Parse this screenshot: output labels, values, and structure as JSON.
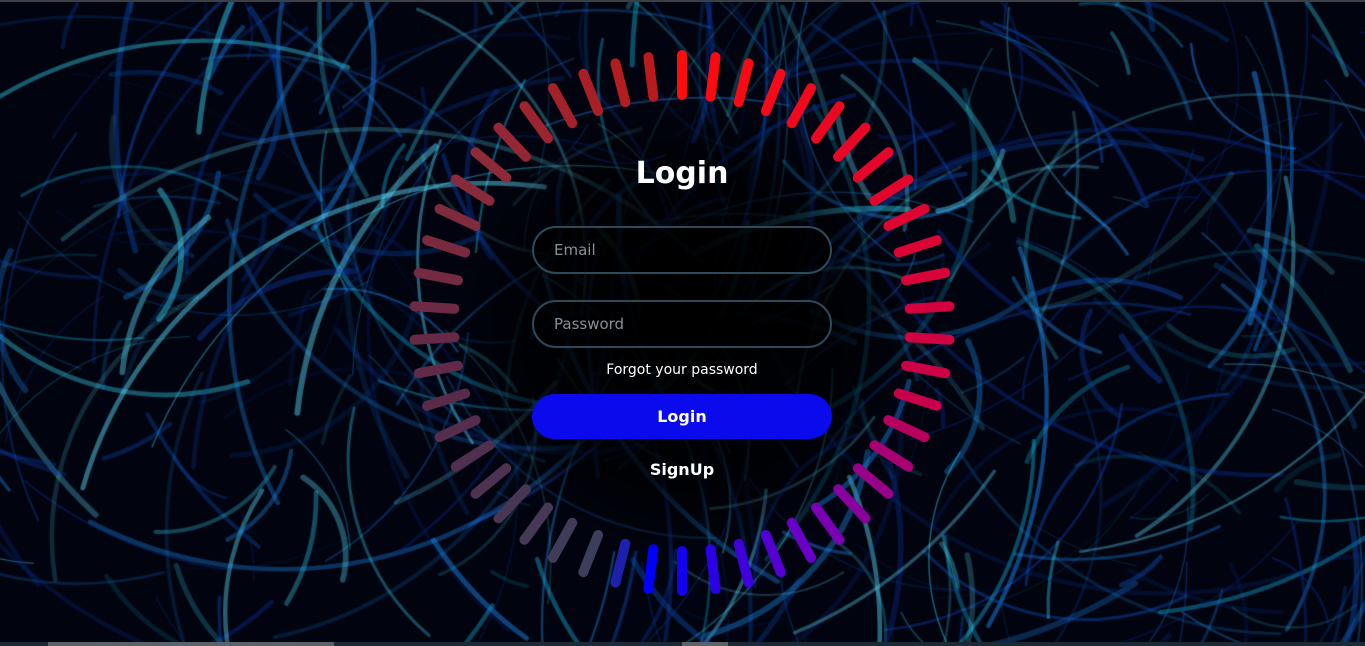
{
  "login": {
    "title": "Login",
    "email_placeholder": "Email",
    "password_placeholder": "Password",
    "forgot_link": "Forgot your password",
    "login_button": "Login",
    "signup_link": "SignUp"
  },
  "colors": {
    "login_button": "#0a0aec",
    "ring_red": "#ff0c0c",
    "ring_blue": "#0000ff",
    "ring_slate": "#3c3f5a",
    "ring_maroon": "#8a2a3a"
  }
}
